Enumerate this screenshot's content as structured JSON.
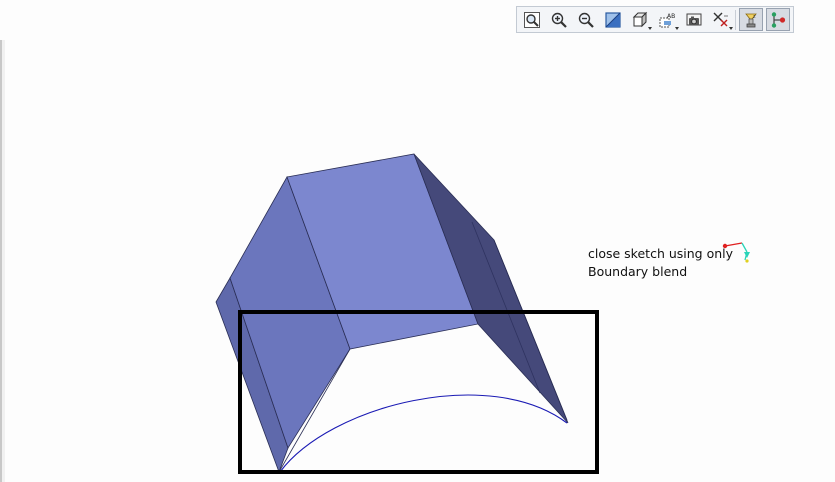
{
  "toolbar": {
    "buttons": [
      {
        "icon": "zoom-to-fit-icon"
      },
      {
        "icon": "zoom-in-icon"
      },
      {
        "icon": "zoom-out-icon"
      },
      {
        "icon": "section-view-icon"
      },
      {
        "icon": "view-orientation-icon"
      },
      {
        "icon": "display-style-icon"
      },
      {
        "icon": "camera-icon"
      },
      {
        "icon": "hide-show-items-icon"
      },
      {
        "icon": "lights-icon"
      },
      {
        "icon": "view-settings-icon"
      }
    ]
  },
  "colors": {
    "front_face": "#7c87cf",
    "left_face": "#6b76bd",
    "left_strip": "#5f69ab",
    "right_face": "#45497a",
    "curve": "#1a1ab4",
    "annotation_box": "#000000",
    "triad_x": "#e02020",
    "triad_y": "#2ad4b8"
  },
  "annotation": {
    "line1": "close sketch using only",
    "line2": "Boundary blend"
  }
}
